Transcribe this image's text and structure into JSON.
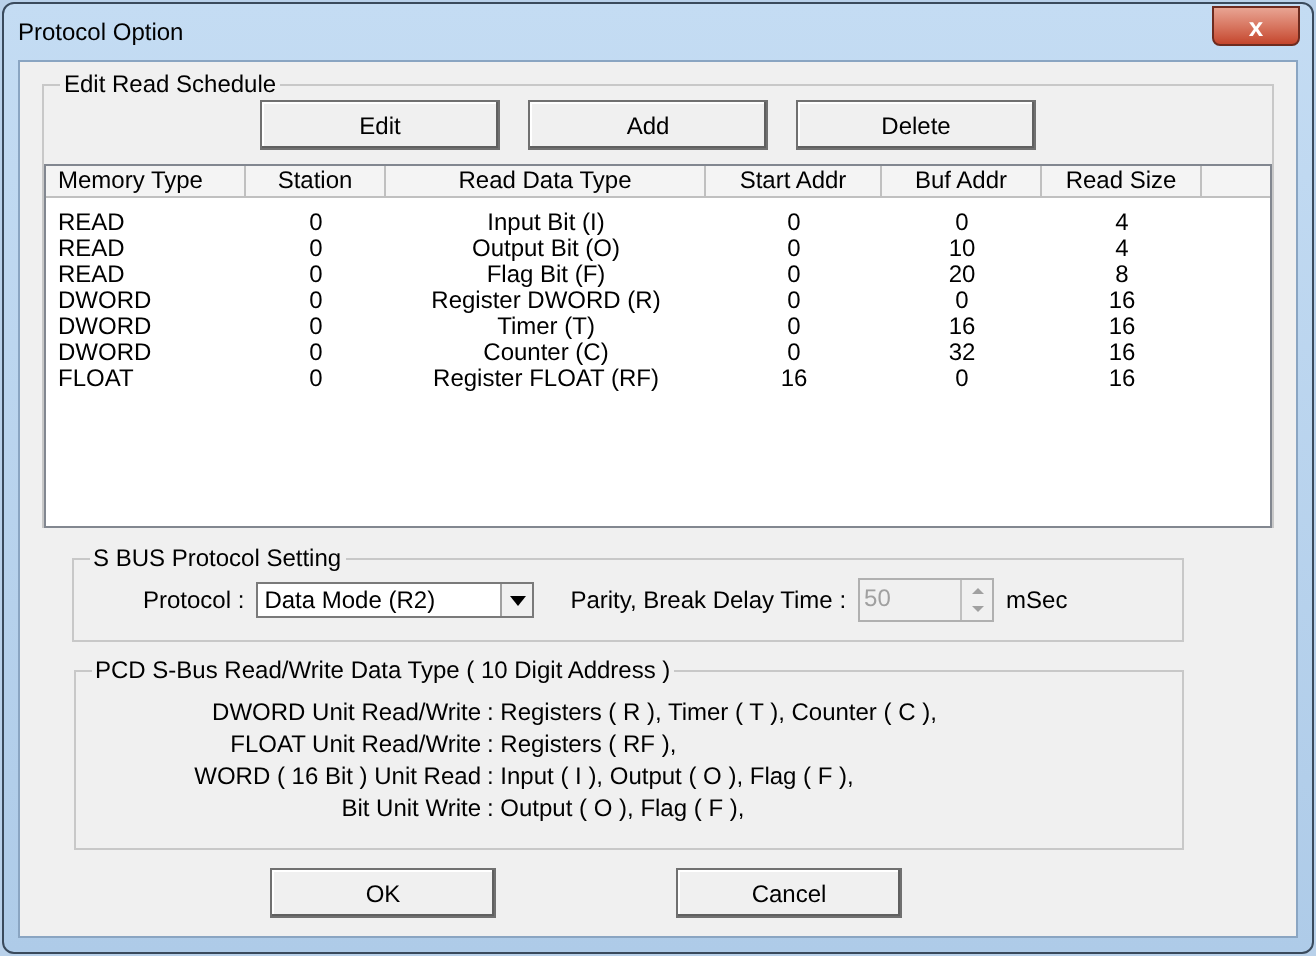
{
  "window": {
    "title": "Protocol Option",
    "close": "x"
  },
  "schedule": {
    "title": "Edit Read Schedule",
    "buttons": [
      "Edit",
      "Add",
      "Delete"
    ],
    "columns": [
      "Memory Type",
      "Station",
      "Read Data Type",
      "Start Addr",
      "Buf Addr",
      "Read Size"
    ],
    "rows": [
      [
        "READ",
        "0",
        "Input Bit (I)",
        "0",
        "0",
        "4"
      ],
      [
        "READ",
        "0",
        "Output Bit (O)",
        "0",
        "10",
        "4"
      ],
      [
        "READ",
        "0",
        "Flag Bit (F)",
        "0",
        "20",
        "8"
      ],
      [
        "DWORD",
        "0",
        "Register DWORD (R)",
        "0",
        "0",
        "16"
      ],
      [
        "DWORD",
        "0",
        "Timer (T)",
        "0",
        "16",
        "16"
      ],
      [
        "DWORD",
        "0",
        "Counter (C)",
        "0",
        "32",
        "16"
      ],
      [
        "FLOAT",
        "0",
        "Register FLOAT (RF)",
        "16",
        "0",
        "16"
      ]
    ]
  },
  "sbus": {
    "title": "S BUS Protocol Setting",
    "protocol_label": "Protocol :",
    "protocol_value": "Data Mode (R2)",
    "delay_label": "Parity, Break Delay Time :",
    "delay_value": "50",
    "delay_disabled": true,
    "delay_unit": "mSec"
  },
  "pcd": {
    "title": "PCD S-Bus Read/Write Data Type ( 10 Digit Address )",
    "lines": [
      {
        "label": "DWORD Unit Read/Write",
        "value": ": Registers ( R ), Timer ( T ), Counter ( C ),"
      },
      {
        "label": "FLOAT Unit Read/Write",
        "value": ": Registers ( RF ),"
      },
      {
        "label": "WORD ( 16 Bit ) Unit Read",
        "value": ": Input ( I ), Output ( O ), Flag ( F ),"
      },
      {
        "label": "Bit Unit Write",
        "value": ": Output ( O ), Flag ( F ),"
      }
    ]
  },
  "buttons": [
    "OK",
    "Cancel"
  ]
}
